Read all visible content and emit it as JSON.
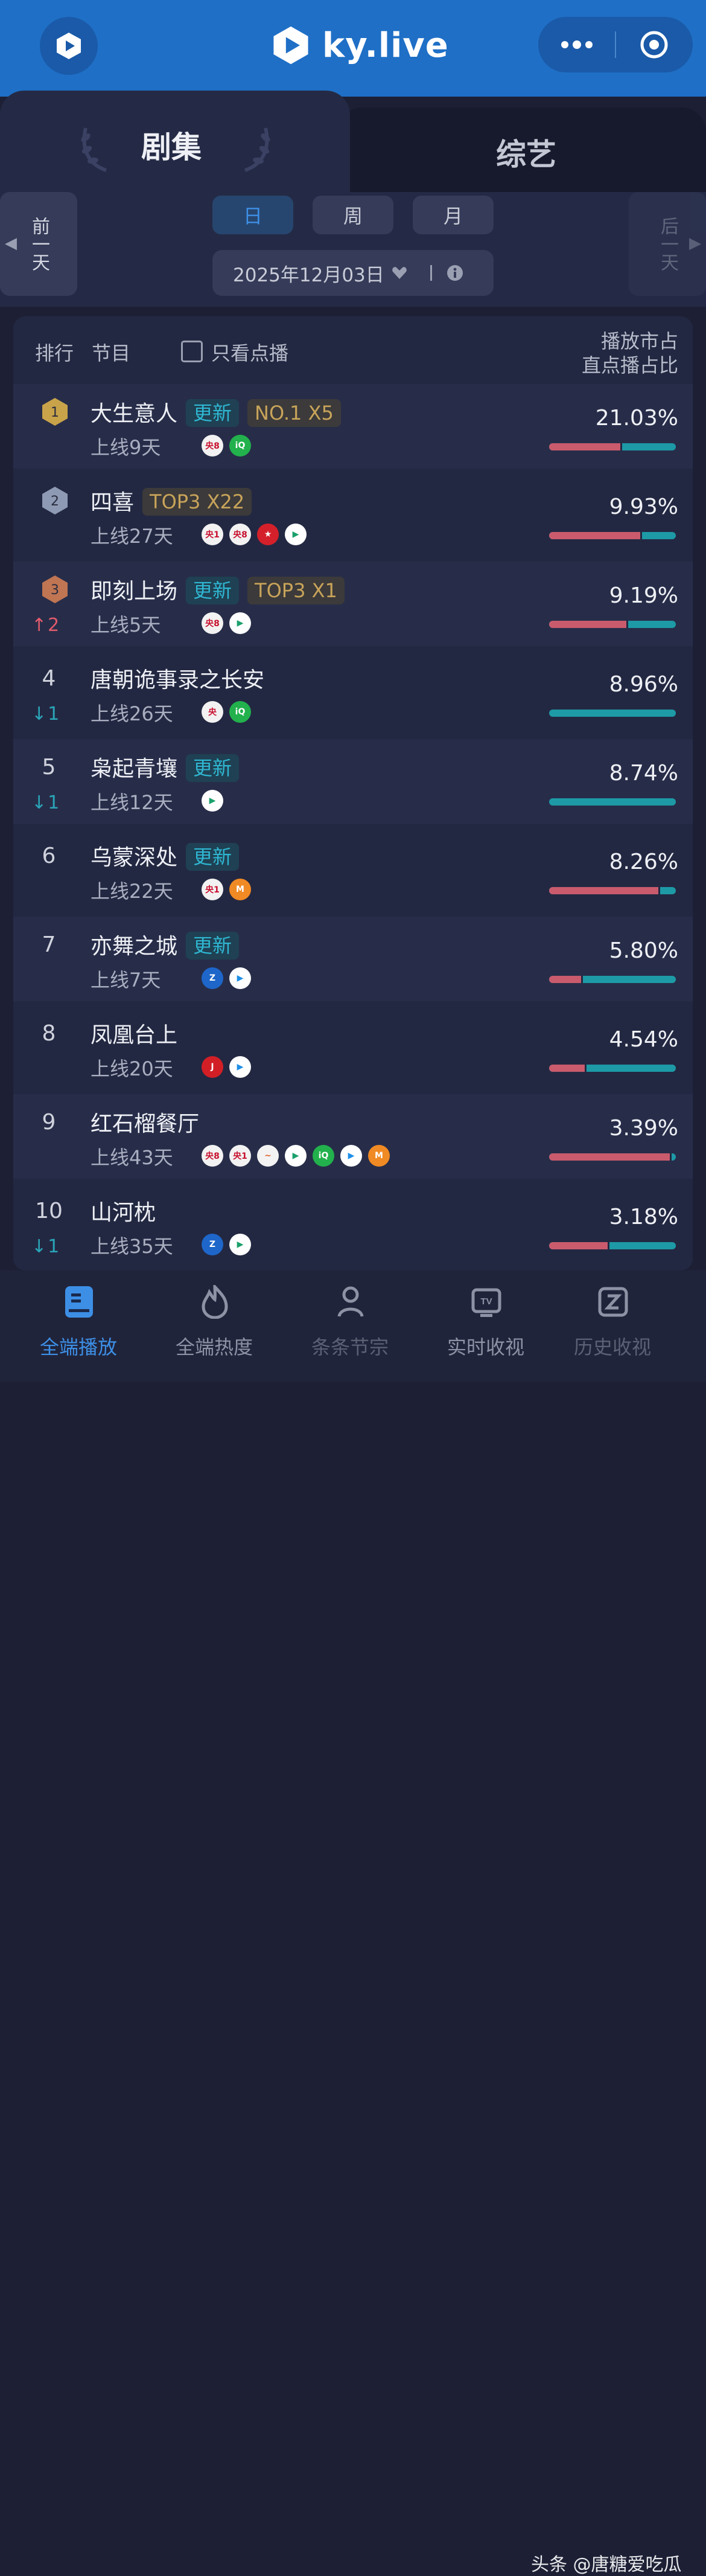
{
  "header": {
    "logo_text": "ky.live"
  },
  "tabs": [
    {
      "label": "剧集",
      "active": true
    },
    {
      "label": "综艺",
      "active": false
    }
  ],
  "date_nav": {
    "prev_label": "前一天",
    "next_label": "后一天",
    "periods": [
      {
        "label": "日",
        "active": true
      },
      {
        "label": "周",
        "active": false
      },
      {
        "label": "月",
        "active": false
      }
    ],
    "current_date": "2025年12月03日"
  },
  "list_header": {
    "rank": "排行",
    "program": "节目",
    "filter_label": "只看点播",
    "metric_line1": "播放市占",
    "metric_line2": "直点播占比"
  },
  "rows": [
    {
      "rank": "1",
      "medal": "gold",
      "title": "大生意人",
      "badges": [
        {
          "text": "更新",
          "kind": "upd"
        },
        {
          "text": "NO.1 X5",
          "kind": "gold"
        }
      ],
      "online": "上线9天",
      "change": "",
      "change_dir": "",
      "platforms": [
        "cctv8-icon",
        "iqiyi-icon"
      ],
      "share": "21.03%",
      "live_ratio": 0.56
    },
    {
      "rank": "2",
      "medal": "silver",
      "title": "四喜",
      "badges": [
        {
          "text": "TOP3 X22",
          "kind": "gold"
        }
      ],
      "online": "上线27天",
      "change": "",
      "change_dir": "",
      "platforms": [
        "cctv1-icon",
        "cctv8-icon",
        "dragon-tv-icon",
        "tencent-video-icon"
      ],
      "share": "9.93%",
      "live_ratio": 0.72
    },
    {
      "rank": "3",
      "medal": "bronze",
      "title": "即刻上场",
      "badges": [
        {
          "text": "更新",
          "kind": "upd"
        },
        {
          "text": "TOP3 X1",
          "kind": "gold"
        }
      ],
      "online": "上线5天",
      "change": "2",
      "change_dir": "up",
      "platforms": [
        "cctv8-icon",
        "tencent-video-icon"
      ],
      "share": "9.19%",
      "live_ratio": 0.61
    },
    {
      "rank": "4",
      "medal": "",
      "title": "唐朝诡事录之长安",
      "badges": [],
      "online": "上线26天",
      "change": "1",
      "change_dir": "down",
      "platforms": [
        "cctv-drama-icon",
        "iqiyi-icon"
      ],
      "share": "8.96%",
      "live_ratio": 0.0
    },
    {
      "rank": "5",
      "medal": "",
      "title": "枭起青壤",
      "badges": [
        {
          "text": "更新",
          "kind": "upd"
        }
      ],
      "online": "上线12天",
      "change": "1",
      "change_dir": "down",
      "platforms": [
        "tencent-video-icon"
      ],
      "share": "8.74%",
      "live_ratio": 0.0
    },
    {
      "rank": "6",
      "medal": "",
      "title": "乌蒙深处",
      "badges": [
        {
          "text": "更新",
          "kind": "upd"
        }
      ],
      "online": "上线22天",
      "change": "",
      "change_dir": "",
      "platforms": [
        "cctv1-icon",
        "mango-tv-icon"
      ],
      "share": "8.26%",
      "live_ratio": 0.86
    },
    {
      "rank": "7",
      "medal": "",
      "title": "亦舞之城",
      "badges": [
        {
          "text": "更新",
          "kind": "upd"
        }
      ],
      "online": "上线7天",
      "change": "",
      "change_dir": "",
      "platforms": [
        "zhejiang-tv-icon",
        "youku-icon"
      ],
      "share": "5.80%",
      "live_ratio": 0.25
    },
    {
      "rank": "8",
      "medal": "",
      "title": "凤凰台上",
      "badges": [],
      "online": "上线20天",
      "change": "",
      "change_dir": "",
      "platforms": [
        "jiangsu-tv-icon",
        "youku-icon"
      ],
      "share": "4.54%",
      "live_ratio": 0.28
    },
    {
      "rank": "9",
      "medal": "",
      "title": "红石榴餐厅",
      "badges": [],
      "online": "上线43天",
      "change": "",
      "change_dir": "",
      "platforms": [
        "cctv8-icon",
        "cctv1-icon",
        "hunan-tv-icon",
        "tencent-video-icon",
        "iqiyi-icon",
        "youku-icon",
        "mango-tv-icon"
      ],
      "share": "3.39%",
      "live_ratio": 0.95
    },
    {
      "rank": "10",
      "medal": "",
      "title": "山河枕",
      "badges": [],
      "online": "上线35天",
      "change": "1",
      "change_dir": "down",
      "platforms": [
        "zhejiang-tv-icon",
        "tencent-video-icon"
      ],
      "share": "3.18%",
      "live_ratio": 0.46
    }
  ],
  "platform_glyphs": {
    "cctv8-icon": {
      "text": "央8",
      "bg": "#f2f2f2",
      "fg": "#c8102e"
    },
    "cctv1-icon": {
      "text": "央1",
      "bg": "#f2f2f2",
      "fg": "#c8102e"
    },
    "cctv-drama-icon": {
      "text": "央",
      "bg": "#f2f2f2",
      "fg": "#c8102e"
    },
    "iqiyi-icon": {
      "text": "iQ",
      "bg": "#22b14c",
      "fg": "#ffffff"
    },
    "tencent-video-icon": {
      "text": "▶",
      "bg": "#ffffff",
      "fg": "#1aa06b"
    },
    "dragon-tv-icon": {
      "text": "★",
      "bg": "#d4202a",
      "fg": "#ffffff"
    },
    "mango-tv-icon": {
      "text": "M",
      "bg": "#f08a24",
      "fg": "#ffffff"
    },
    "zhejiang-tv-icon": {
      "text": "Z",
      "bg": "#1e66c9",
      "fg": "#ffffff"
    },
    "youku-icon": {
      "text": "▶",
      "bg": "#ffffff",
      "fg": "#1d8fe8"
    },
    "jiangsu-tv-icon": {
      "text": "J",
      "bg": "#d21f26",
      "fg": "#ffffff"
    },
    "hunan-tv-icon": {
      "text": "~",
      "bg": "#f3f3f3",
      "fg": "#e0622a"
    }
  },
  "colors": {
    "accent": "#3d8fe6",
    "vod": "#c95b6d",
    "live": "#1d9aa6",
    "up": "#e05a6c",
    "down": "#2aa5b8"
  },
  "bottom_nav": [
    {
      "label": "全端播放",
      "icon": "chart-book-icon",
      "active": true
    },
    {
      "label": "全端热度",
      "icon": "flame-icon",
      "active": false
    },
    {
      "label": "条条节宗",
      "icon": "person-icon",
      "active": false
    },
    {
      "label": "实时收视",
      "icon": "tv-icon",
      "active": false
    },
    {
      "label": "历史收视",
      "icon": "clock-box-icon",
      "active": false
    }
  ],
  "watermark": "头条 @唐糖爱吃瓜"
}
